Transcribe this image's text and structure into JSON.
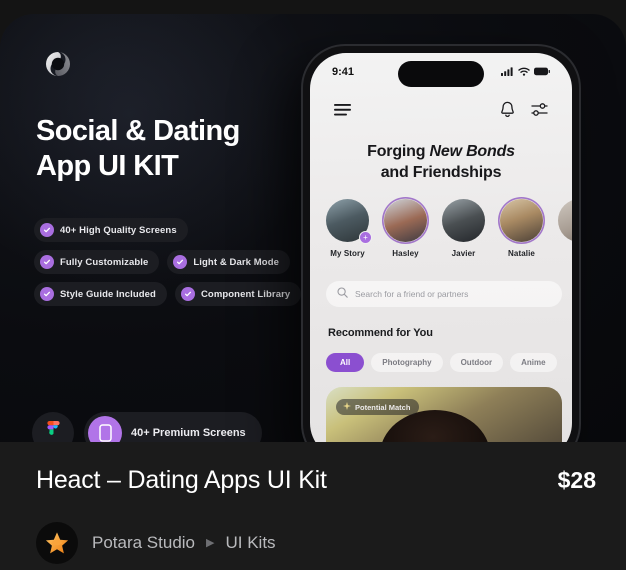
{
  "theme": {
    "page_bg": "#141414",
    "hero_bg": "#0b0c10",
    "footer_bg": "#1b1b1b",
    "accent_purple": "#a96ee0",
    "chip_active": "#8b4fd0",
    "star_orange": "#f59322",
    "text_primary": "#ffffff",
    "text_muted": "#b9babd"
  },
  "hero": {
    "logo_icon": "spiral-logo-icon",
    "headline_line1": "Social & Dating",
    "headline_line2": "App UI KIT",
    "features": [
      {
        "label": "40+ High Quality Screens",
        "icon": "check-circle-icon"
      },
      {
        "label": "Fully Customizable",
        "icon": "check-circle-icon"
      },
      {
        "label": "Light & Dark Mode",
        "icon": "check-circle-icon"
      },
      {
        "label": "Style Guide Included",
        "icon": "check-circle-icon"
      },
      {
        "label": "Component Library",
        "icon": "check-circle-icon"
      }
    ],
    "badges": {
      "figma_icon": "figma-logo-icon",
      "premium_icon": "mobile-phone-icon",
      "premium_label": "40+ Premium Screens"
    }
  },
  "phone": {
    "status_bar": {
      "time": "9:41",
      "icons": [
        "cellular-signal-icon",
        "wifi-icon",
        "battery-icon"
      ]
    },
    "nav": {
      "menu_icon": "hamburger-menu-icon",
      "bell_icon": "notification-bell-icon",
      "filter_icon": "filter-sliders-icon"
    },
    "headline": {
      "part1": "Forging ",
      "part_italic": "New Bonds",
      "part2": "and Friendships"
    },
    "stories": [
      {
        "name": "My Story",
        "ringed": false,
        "has_plus": true
      },
      {
        "name": "Hasley",
        "ringed": true,
        "has_plus": false
      },
      {
        "name": "Javier",
        "ringed": false,
        "has_plus": false
      },
      {
        "name": "Natalie",
        "ringed": true,
        "has_plus": false
      },
      {
        "name": "",
        "ringed": false,
        "has_plus": false
      }
    ],
    "search": {
      "icon": "search-icon",
      "placeholder": "Search for a friend or partners"
    },
    "section_title": "Recommend for You",
    "chips": [
      {
        "label": "All",
        "active": true
      },
      {
        "label": "Photography",
        "active": false
      },
      {
        "label": "Outdoor",
        "active": false
      },
      {
        "label": "Anime",
        "active": false
      }
    ],
    "match_card": {
      "badge_icon": "sparkle-icon",
      "badge_label": "Potential Match"
    }
  },
  "footer": {
    "product_title": "Heact – Dating Apps UI Kit",
    "price": "$28",
    "author_avatar_icon": "star-avatar-icon",
    "author_name": "Potara Studio",
    "breadcrumb_separator": "▶",
    "category": "UI Kits"
  }
}
